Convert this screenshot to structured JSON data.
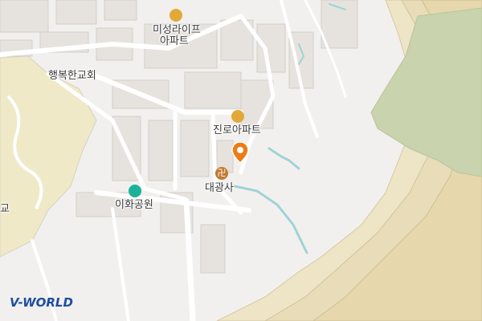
{
  "labels": {
    "misung_apt_line1": "미성라이프",
    "misung_apt_line2": "아파트",
    "haengbok_church": "행복한교회",
    "jinro_apt": "진로아파트",
    "daegwangsa": "대광사",
    "ihwa_park": "이화공원",
    "school_partial": "교"
  },
  "brand": {
    "logo_text": "V-WORLD"
  },
  "colors": {
    "background": "#f2f0ee",
    "block": "#e7e4e1",
    "road": "#ffffff",
    "green_area": "#c9d3ae",
    "terrain": "#f0e6cc",
    "park_green": "#e8ecd6",
    "water": "#9fd3d8",
    "marker": "#f07a14",
    "brand_blue": "#1c4fa0"
  },
  "icons": {
    "apartment": "apartment-icon",
    "temple": "temple-icon",
    "park": "park-icon",
    "location": "location-pin-icon"
  }
}
